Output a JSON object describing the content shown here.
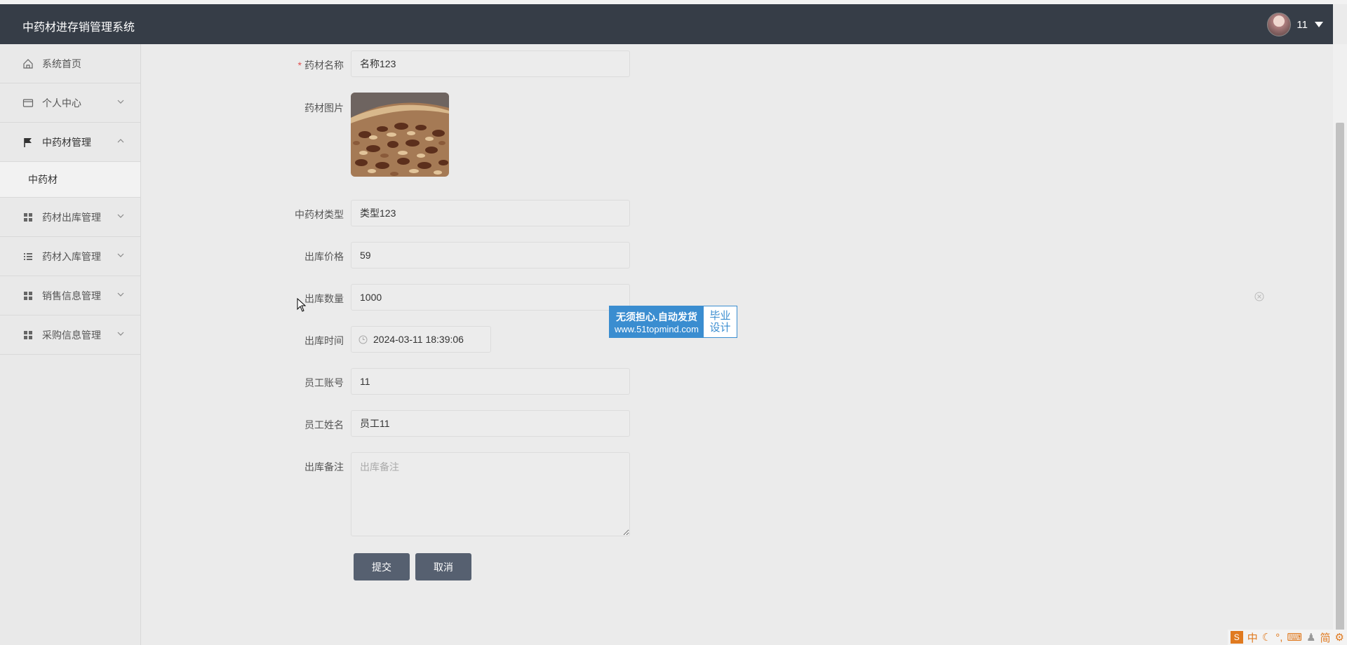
{
  "app": {
    "title": "中药材进存销管理系统"
  },
  "user": {
    "name": "11"
  },
  "sidebar": {
    "items": [
      {
        "label": "系统首页",
        "icon": "home-icon"
      },
      {
        "label": "个人中心",
        "icon": "card-icon"
      },
      {
        "label": "中药材管理",
        "icon": "flag-icon"
      },
      {
        "label": "中药材",
        "icon": ""
      },
      {
        "label": "药材出库管理",
        "icon": "grid-icon"
      },
      {
        "label": "药材入库管理",
        "icon": "list-icon"
      },
      {
        "label": "销售信息管理",
        "icon": "grid-icon"
      },
      {
        "label": "采购信息管理",
        "icon": "grid-icon"
      }
    ]
  },
  "form": {
    "name_label": "药材名称",
    "name_value": "名称123",
    "image_label": "药材图片",
    "type_label": "中药材类型",
    "type_value": "类型123",
    "price_label": "出库价格",
    "price_value": "59",
    "qty_label": "出库数量",
    "qty_value": "1000",
    "time_label": "出库时间",
    "time_value": "2024-03-11 18:39:06",
    "account_label": "员工账号",
    "account_value": "11",
    "staff_label": "员工姓名",
    "staff_value": "员工11",
    "note_label": "出库备注",
    "note_placeholder": "出库备注",
    "submit_label": "提交",
    "cancel_label": "取消"
  },
  "watermark": {
    "line1": "无须担心.自动发货",
    "line2": "www.51topmind.com",
    "right1": "毕业",
    "right2": "设计"
  },
  "tray": {
    "items": [
      "中",
      "简"
    ]
  },
  "colors": {
    "header": "#363d47",
    "button": "#566070",
    "watermark": "#3a8dd0"
  }
}
